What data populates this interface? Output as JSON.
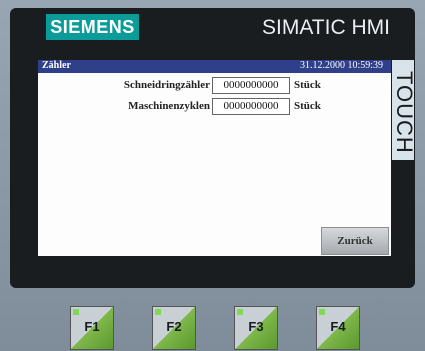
{
  "device": {
    "logo": "SIEMENS",
    "brand": "SIMATIC HMI",
    "touch_label": "TOUCH"
  },
  "screen": {
    "title": "Zähler",
    "datetime": "31.12.2000 10:59:39",
    "rows": [
      {
        "label": "Schneidringzähler",
        "value": "0000000000",
        "unit": "Stück"
      },
      {
        "label": "Maschinenzyklen",
        "value": "0000000000",
        "unit": "Stück"
      }
    ],
    "back_button": "Zurück"
  },
  "function_keys": [
    "F1",
    "F2",
    "F3",
    "F4"
  ]
}
